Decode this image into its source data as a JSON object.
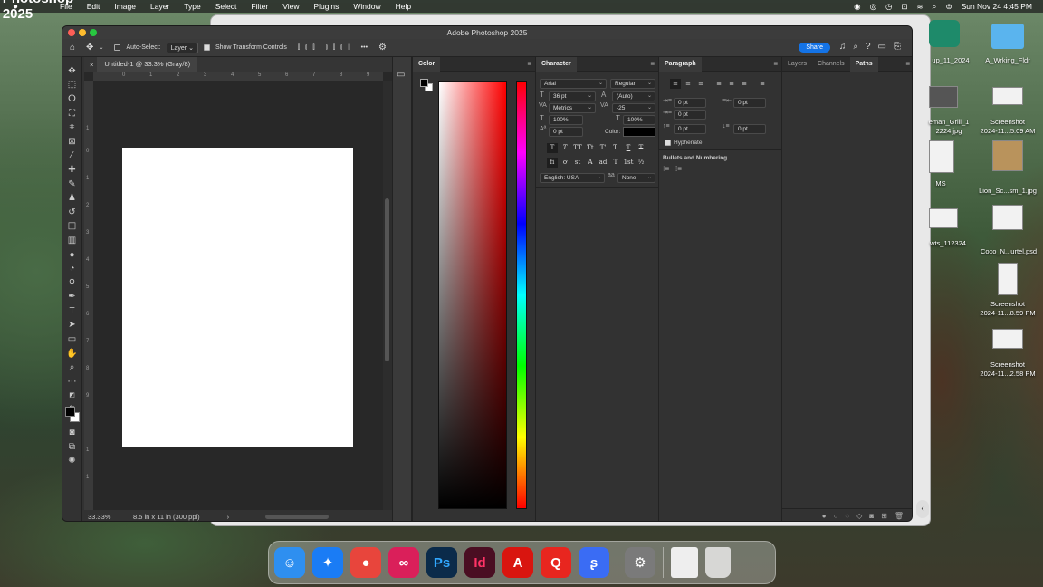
{
  "menubar": {
    "app_name": "Photoshop 2025",
    "items": [
      "File",
      "Edit",
      "Image",
      "Layer",
      "Type",
      "Select",
      "Filter",
      "View",
      "Plugins",
      "Window",
      "Help"
    ],
    "datetime": "Sun Nov 24  4:45 PM"
  },
  "window": {
    "title": "Adobe Photoshop 2025"
  },
  "options_bar": {
    "auto_select_label": "Auto-Select:",
    "auto_select_value": "Layer",
    "transform_label": "Show Transform Controls",
    "more": "•••",
    "share_label": "Share"
  },
  "document": {
    "tab_title": "Untitled-1 @ 33.3% (Gray/8)",
    "ruler_h": [
      "0",
      "1",
      "2",
      "3",
      "4",
      "5",
      "6",
      "7",
      "8",
      "9"
    ],
    "ruler_v": [
      "1",
      "0",
      "1",
      "2",
      "3",
      "4",
      "5",
      "6",
      "7",
      "8",
      "9",
      "1",
      "1"
    ],
    "zoom": "33.33%",
    "doc_info": "8.5 in x 11 in (300 ppi)",
    "status_arrow": "›"
  },
  "color_panel": {
    "title": "Color",
    "hue_colors": [
      "#ff0000",
      "#ff00ff",
      "#0000ff",
      "#00ffff",
      "#00ff00",
      "#ffff00",
      "#ff0000"
    ],
    "base_color": "#ff0000"
  },
  "character_panel": {
    "title": "Character",
    "font": "Arial",
    "style": "Regular",
    "size": "36 pt",
    "leading": "(Auto)",
    "kerning": "Metrics",
    "tracking": "-25",
    "vscale": "100%",
    "hscale": "100%",
    "baseline": "0 pt",
    "color_label": "Color:",
    "language": "English: USA",
    "aa_icon": "aa",
    "antialias": "None",
    "glyph_row1": [
      "T",
      "T",
      "TT",
      "Tt",
      "T'",
      "T,",
      "T",
      "T"
    ],
    "glyph_row2": [
      "fi",
      "ơ",
      "st",
      "A",
      "ad",
      "T",
      "1st",
      "½"
    ]
  },
  "paragraph_panel": {
    "title": "Paragraph",
    "indent_left": "0 pt",
    "indent_right": "0 pt",
    "first_line": "0 pt",
    "space_before": "0 pt",
    "space_after": "0 pt",
    "hyphenate_label": "Hyphenate",
    "bullets_label": "Bullets and Numbering"
  },
  "layers_panel": {
    "tabs": [
      "Layers",
      "Channels",
      "Paths"
    ],
    "active": "Paths"
  },
  "desktop": {
    "icons": [
      {
        "label": "up_11_2024"
      },
      {
        "label": "A_Wrking_Fldr"
      },
      {
        "label": "eman_Grill_1\n2224.jpg"
      },
      {
        "label": "Screenshot\n2024-11...5.09 AM"
      },
      {
        "label": "MS"
      },
      {
        "label": "Lion_Sc...sm_1.jpg"
      },
      {
        "label": "wts_112324"
      },
      {
        "label": "Coco_N...urtel.psd"
      },
      {
        "label": "Screenshot\n2024-11...8.59 PM"
      },
      {
        "label": "Screenshot\n2024-11...2.58 PM"
      }
    ]
  },
  "dock": {
    "apps": [
      {
        "name": "finder",
        "glyph": "☺",
        "color": "#2e8ff0"
      },
      {
        "name": "safari",
        "glyph": "✦",
        "color": "#1a7cf5"
      },
      {
        "name": "chrome",
        "glyph": "●",
        "color": "#e8453c"
      },
      {
        "name": "creative-cloud",
        "glyph": "∞",
        "color": "#da1f5a"
      },
      {
        "name": "photoshop",
        "glyph": "Ps",
        "color": "#0b2b4a"
      },
      {
        "name": "indesign",
        "glyph": "Id",
        "color": "#4a0e22"
      },
      {
        "name": "acrobat",
        "glyph": "A",
        "color": "#d9150f"
      },
      {
        "name": "adobe-express",
        "glyph": "Q",
        "color": "#e8261f"
      },
      {
        "name": "signal",
        "glyph": "ʂ",
        "color": "#3a6cf4"
      },
      {
        "name": "system-settings",
        "glyph": "⚙",
        "color": "#7a7a7a"
      }
    ]
  }
}
